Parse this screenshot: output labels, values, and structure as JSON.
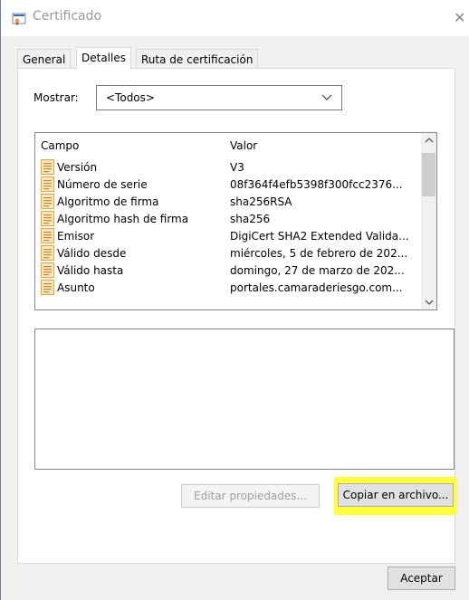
{
  "window": {
    "title": "Certificado"
  },
  "tabs": [
    {
      "label": "General",
      "active": false
    },
    {
      "label": "Detalles",
      "active": true
    },
    {
      "label": "Ruta de certificación",
      "active": false
    }
  ],
  "show": {
    "label": "Mostrar:",
    "selected": "<Todos>"
  },
  "list": {
    "columns": [
      "Campo",
      "Valor"
    ],
    "rows": [
      {
        "field": "Versión",
        "value": "V3"
      },
      {
        "field": "Número de serie",
        "value": "08f364f4efb5398f300fcc2376..."
      },
      {
        "field": "Algoritmo de firma",
        "value": "sha256RSA"
      },
      {
        "field": "Algoritmo hash de firma",
        "value": "sha256"
      },
      {
        "field": "Emisor",
        "value": "DigiCert SHA2 Extended Valida..."
      },
      {
        "field": "Válido desde",
        "value": "miércoles, 5 de febrero de 202..."
      },
      {
        "field": "Válido hasta",
        "value": "domingo, 27 de marzo de 202..."
      },
      {
        "field": "Asunto",
        "value": "portales.camaraderiesgo.com..."
      }
    ]
  },
  "buttons": {
    "edit_properties": "Editar propiedades...",
    "copy_to_file": "Copiar en archivo...",
    "accept": "Aceptar"
  },
  "colors": {
    "highlight": "#ffff3a",
    "field_icon": "#e8a33c"
  }
}
